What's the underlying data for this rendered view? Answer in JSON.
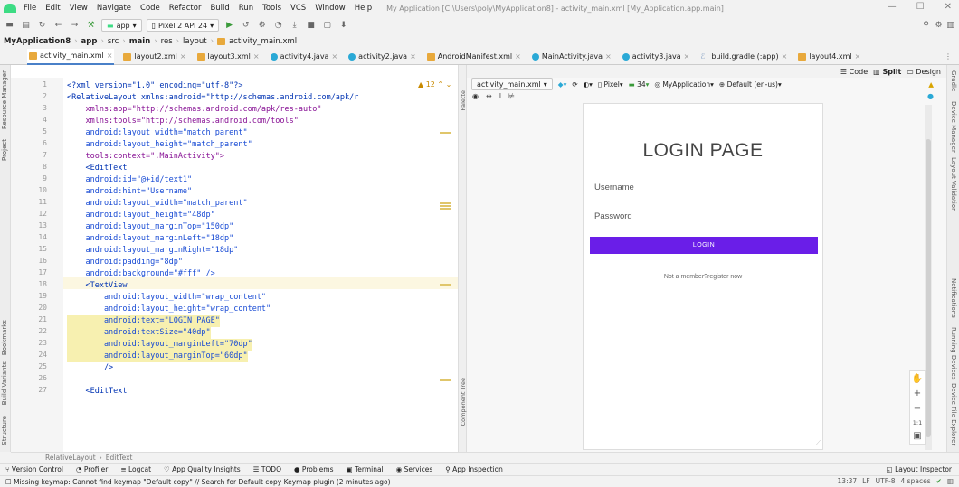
{
  "menubar": {
    "items": [
      "File",
      "Edit",
      "View",
      "Navigate",
      "Code",
      "Refactor",
      "Build",
      "Run",
      "Tools",
      "VCS",
      "Window",
      "Help"
    ],
    "window_title": "My Application [C:\\Users\\poly\\MyApplication8] - activity_main.xml [My_Application.app.main]"
  },
  "toolbar": {
    "module": "app",
    "device": "Pixel 2 API 24"
  },
  "breadcrumb": [
    "MyApplication8",
    "app",
    "src",
    "main",
    "res",
    "layout",
    "activity_main.xml"
  ],
  "tabs": [
    "activity_main.xml",
    "layout2.xml",
    "layout3.xml",
    "activity4.java",
    "activity2.java",
    "AndroidManifest.xml",
    "MainActivity.java",
    "activity3.java",
    "build.gradle (:app)",
    "layout4.xml"
  ],
  "left_tools": [
    "Resource Manager",
    "Project",
    "Bookmarks",
    "Build Variants",
    "Structure"
  ],
  "right_tools": [
    "Gradle",
    "Device Manager",
    "Layout Validation",
    "Notifications",
    "Running Devices",
    "Device File Explorer"
  ],
  "editor": {
    "warning_count": "12",
    "line_numbers": [
      "1",
      "2",
      "3",
      "4",
      "5",
      "6",
      "7",
      "8",
      "9",
      "10",
      "11",
      "12",
      "13",
      "14",
      "15",
      "16",
      "17",
      "18",
      "19",
      "20",
      "21",
      "22",
      "23",
      "24",
      "25",
      "26",
      "27"
    ],
    "lines": [
      "<?xml version=\"1.0\" encoding=\"utf-8\"?>",
      "<RelativeLayout xmlns:android=\"http://schemas.android.com/apk/r",
      "    xmlns:app=\"http://schemas.android.com/apk/res-auto\"",
      "    xmlns:tools=\"http://schemas.android.com/tools\"",
      "    android:layout_width=\"match_parent\"",
      "    android:layout_height=\"match_parent\"",
      "    tools:context=\".MainActivity\">",
      "    <EditText",
      "    android:id=\"@+id/text1\"",
      "    android:hint=\"Username\"",
      "    android:layout_width=\"match_parent\"",
      "    android:layout_height=\"48dp\"",
      "    android:layout_marginTop=\"150dp\"",
      "    android:layout_marginLeft=\"18dp\"",
      "    android:layout_marginRight=\"18dp\"",
      "    android:padding=\"8dp\"",
      "    android:background=\"#fff\" />",
      "    <TextView",
      "        android:layout_width=\"wrap_content\"",
      "        android:layout_height=\"wrap_content\"",
      "        android:text=\"LOGIN PAGE\"",
      "        android:textSize=\"40dp\"",
      "        android:layout_marginLeft=\"70dp\"",
      "        android:layout_marginTop=\"60dp\"",
      "        />",
      "",
      "    <EditText"
    ]
  },
  "side_labels": {
    "palette": "Palette",
    "component_tree": "Component Tree"
  },
  "design": {
    "modes": [
      "Code",
      "Split",
      "Design"
    ],
    "file": "activity_main.xml",
    "device": "Pixel",
    "api": "34",
    "theme": "MyApplication",
    "locale": "Default (en-us)",
    "preview": {
      "title": "LOGIN PAGE",
      "username_hint": "Username",
      "password_hint": "Password",
      "login_button": "LOGIN",
      "register_text": "Not a member?register now"
    },
    "zoom_ratio": "1:1"
  },
  "crumb": [
    "RelativeLayout",
    "EditText"
  ],
  "bottom_tools": [
    "Version Control",
    "Profiler",
    "Logcat",
    "App Quality Insights",
    "TODO",
    "Problems",
    "Terminal",
    "Services",
    "App Inspection"
  ],
  "layout_inspector": "Layout Inspector",
  "status": {
    "message": "Missing keymap: Cannot find keymap \"Default copy\" // Search for Default copy Keymap plugin (2 minutes ago)",
    "time": "13:37",
    "line_sep": "LF",
    "encoding": "UTF-8",
    "indent": "4 spaces"
  }
}
